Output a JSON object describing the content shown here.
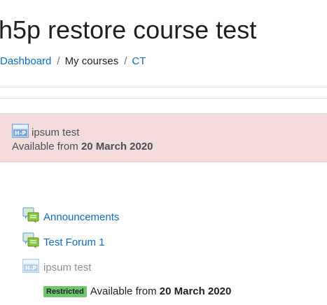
{
  "page": {
    "title": "h5p restore course test"
  },
  "breadcrumb": {
    "items": [
      {
        "label": "Dashboard",
        "link": true
      },
      {
        "label": "My courses",
        "link": false
      },
      {
        "label": "CT",
        "link": true
      }
    ],
    "separator": "/"
  },
  "highlighted_activity": {
    "name": "ipsum test",
    "availability_prefix": "Available from",
    "availability_date": "20 March 2020",
    "icon": "h5p-icon"
  },
  "activities": [
    {
      "name": "Announcements",
      "icon": "forum-icon",
      "link": true
    },
    {
      "name": "Test Forum 1",
      "icon": "forum-icon",
      "link": true
    },
    {
      "name": "ipsum test",
      "icon": "h5p-icon",
      "link": false
    }
  ],
  "restriction": {
    "badge": "Restricted",
    "availability_prefix": "Available from",
    "availability_date": "20 March 2020"
  },
  "colors": {
    "link": "#0f6cbf",
    "highlight_bg": "#f4dcdc",
    "badge_bg": "#6ec66e"
  }
}
